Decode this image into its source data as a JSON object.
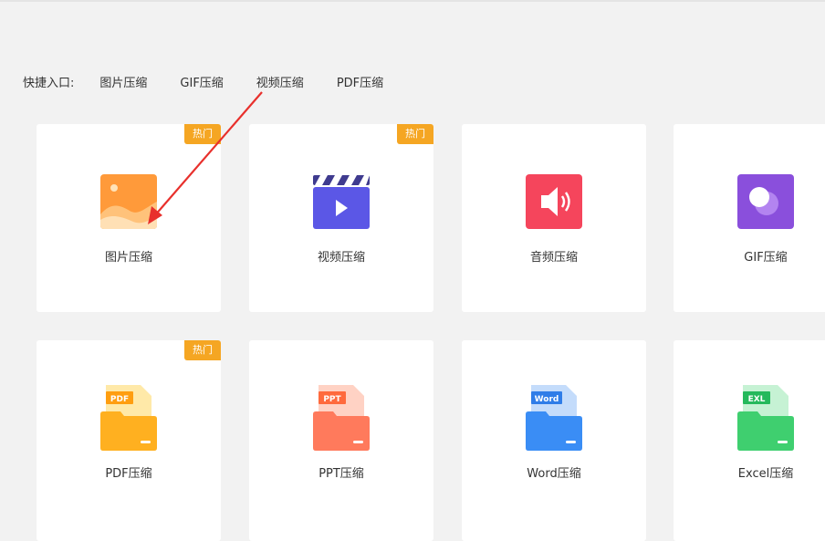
{
  "quick_entry": {
    "label": "快捷入口:",
    "links": [
      "图片压缩",
      "GIF压缩",
      "视频压缩",
      "PDF压缩"
    ]
  },
  "cards": [
    {
      "label": "图片压缩",
      "badge": "热门",
      "icon": "image-icon"
    },
    {
      "label": "视频压缩",
      "badge": "热门",
      "icon": "video-clapper-icon"
    },
    {
      "label": "音频压缩",
      "badge": "",
      "icon": "audio-speaker-icon"
    },
    {
      "label": "GIF压缩",
      "badge": "",
      "icon": "gif-icon"
    },
    {
      "label": "PDF压缩",
      "badge": "热门",
      "icon": "pdf-file-icon"
    },
    {
      "label": "PPT压缩",
      "badge": "",
      "icon": "ppt-file-icon"
    },
    {
      "label": "Word压缩",
      "badge": "",
      "icon": "word-file-icon"
    },
    {
      "label": "Excel压缩",
      "badge": "",
      "icon": "excel-file-icon"
    }
  ],
  "colors": {
    "badge": "#f5a623",
    "image": "#ff9933",
    "video": "#5b57e6",
    "audio": "#f5455c",
    "gif": "#8a4fdc",
    "pdf": "#ffb020",
    "ppt": "#ff7a5c",
    "word": "#3a8df5",
    "excel": "#3fcf6f",
    "annotation_arrow": "#e8302c"
  }
}
